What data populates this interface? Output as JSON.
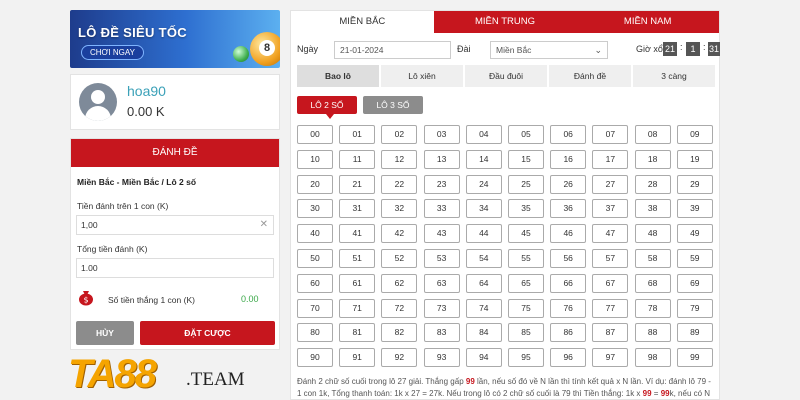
{
  "banner": {
    "title": "LÔ ĐỀ SIÊU TỐC",
    "button": "CHƠI NGAY",
    "ball_number": "8"
  },
  "user": {
    "name": "hoa90",
    "balance": "0.00 K"
  },
  "bet": {
    "header": "ĐÁNH ĐỀ",
    "path": "Miền Bắc - Miền Bắc / Lô 2 số",
    "per_unit_label": "Tiền đánh trên 1 con (K)",
    "per_unit_value": "1,00",
    "total_label": "Tổng tiền đánh (K)",
    "total_value": "1.00",
    "win_label": "Số tiền thắng 1 con (K)",
    "win_value": "0.00",
    "cancel": "HỦY",
    "place": "ĐẶT CƯỢC"
  },
  "logo": {
    "brand": "TA88",
    "suffix": ".TEAM"
  },
  "tabs": [
    "MIỀN BẮC",
    "MIỀN TRUNG",
    "MIỀN NAM"
  ],
  "active_tab": 0,
  "filter": {
    "date_label": "Ngày",
    "date_value": "21-01-2024",
    "region_label": "Đài",
    "region_value": "Miền Bắc",
    "time_label": "Giờ xổ",
    "time": [
      "21",
      "1",
      "31"
    ]
  },
  "modes": [
    "Bao lô",
    "Lô xiên",
    "Đầu đuôi",
    "Đánh đề",
    "3 càng"
  ],
  "active_mode": 0,
  "subtabs": [
    "LÔ 2 SỐ",
    "LÔ 3 SỐ"
  ],
  "numbers": [
    "00",
    "01",
    "02",
    "03",
    "04",
    "05",
    "06",
    "07",
    "08",
    "09",
    "10",
    "11",
    "12",
    "13",
    "14",
    "15",
    "16",
    "17",
    "18",
    "19",
    "20",
    "21",
    "22",
    "23",
    "24",
    "25",
    "26",
    "27",
    "28",
    "29",
    "30",
    "31",
    "32",
    "33",
    "34",
    "35",
    "36",
    "37",
    "38",
    "39",
    "40",
    "41",
    "42",
    "43",
    "44",
    "45",
    "46",
    "47",
    "48",
    "49",
    "50",
    "51",
    "52",
    "53",
    "54",
    "55",
    "56",
    "57",
    "58",
    "59",
    "60",
    "61",
    "62",
    "63",
    "64",
    "65",
    "66",
    "67",
    "68",
    "69",
    "70",
    "71",
    "72",
    "73",
    "74",
    "75",
    "76",
    "77",
    "78",
    "79",
    "80",
    "81",
    "82",
    "83",
    "84",
    "85",
    "86",
    "87",
    "88",
    "89",
    "90",
    "91",
    "92",
    "93",
    "94",
    "95",
    "96",
    "97",
    "98",
    "99"
  ],
  "note": {
    "p1": "Đánh 2 chữ số cuối trong lô 27 giải. Thắng gấp ",
    "h1": "99",
    "p2": " lần, nếu số đó về N lần thì tính kết quả x N lần. Ví dụ: đánh lô 79 - 1 con 1k, Tổng thanh toán: 1k x 27 = 27k. Nếu trong lô có 2 chữ số cuối là 79 thì Tiền thắng: 1k x ",
    "h2": "99",
    "p3": " = ",
    "h3": "99",
    "p4": "k, nếu có N"
  }
}
